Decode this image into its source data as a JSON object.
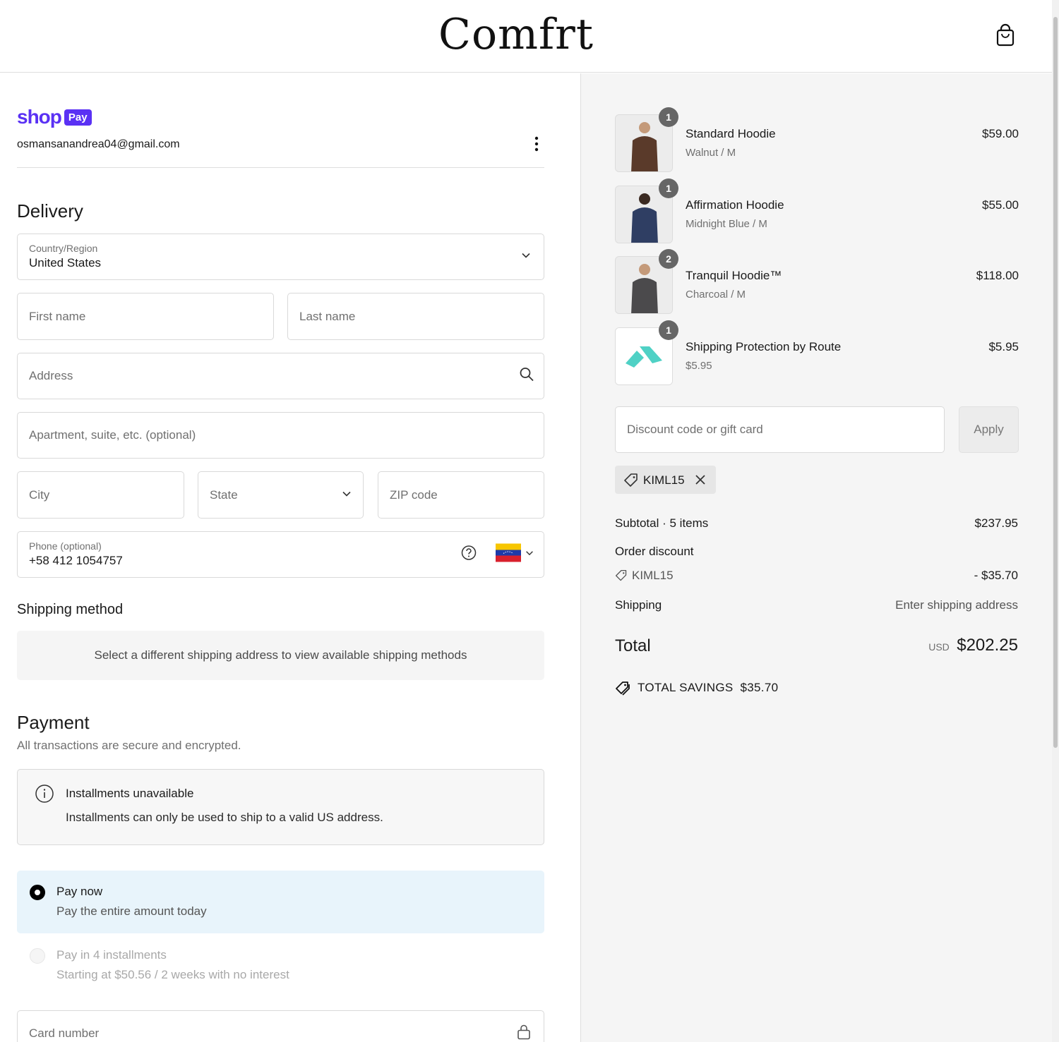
{
  "header": {
    "logo": "Comfrt",
    "cart_icon": "shopping-bag-icon"
  },
  "express": {
    "brand_word": "shop",
    "brand_pill": "Pay",
    "email": "osmansanandrea04@gmail.com",
    "menu_icon": "kebab-icon"
  },
  "delivery": {
    "title": "Delivery",
    "country_label": "Country/Region",
    "country_value": "United States",
    "first_name_placeholder": "First name",
    "last_name_placeholder": "Last name",
    "address_placeholder": "Address",
    "apartment_placeholder": "Apartment, suite, etc. (optional)",
    "city_placeholder": "City",
    "state_placeholder": "State",
    "zip_placeholder": "ZIP code",
    "phone_label": "Phone (optional)",
    "phone_value": "+58 412 1054757"
  },
  "shipping_method": {
    "title": "Shipping method",
    "notice": "Select a different shipping address to view available shipping methods"
  },
  "payment": {
    "title": "Payment",
    "subtitle": "All transactions are secure and encrypted.",
    "installments_title": "Installments unavailable",
    "installments_text": "Installments can only be used to ship to a valid US address.",
    "pay_now_title": "Pay now",
    "pay_now_sub": "Pay the entire amount today",
    "pay_installments_title": "Pay in 4 installments",
    "pay_installments_sub": "Starting at $50.56 / 2 weeks with no interest",
    "card_placeholder": "Card number"
  },
  "summary": {
    "items": [
      {
        "qty": "1",
        "name": "Standard Hoodie",
        "variant": "Walnut / M",
        "price": "$59.00",
        "color": "#5a3a2a"
      },
      {
        "qty": "1",
        "name": "Affirmation Hoodie",
        "variant": "Midnight Blue / M",
        "price": "$55.00",
        "color": "#2f3e63"
      },
      {
        "qty": "2",
        "name": "Tranquil Hoodie™",
        "variant": "Charcoal / M",
        "price": "$118.00",
        "color": "#4b4a4c"
      },
      {
        "qty": "1",
        "name": "Shipping Protection by Route",
        "variant": "$5.95",
        "price": "$5.95",
        "color": "#4fd1c5"
      }
    ],
    "discount_placeholder": "Discount code or gift card",
    "apply_label": "Apply",
    "applied_code": "KIML15",
    "subtotal_label": "Subtotal · 5 items",
    "subtotal_value": "$237.95",
    "order_discount_label": "Order discount",
    "discount_code": "KIML15",
    "discount_value": "- $35.70",
    "shipping_label": "Shipping",
    "shipping_value": "Enter shipping address",
    "total_label": "Total",
    "currency": "USD",
    "total_value": "$202.25",
    "savings_label": "TOTAL SAVINGS",
    "savings_value": "$35.70"
  }
}
